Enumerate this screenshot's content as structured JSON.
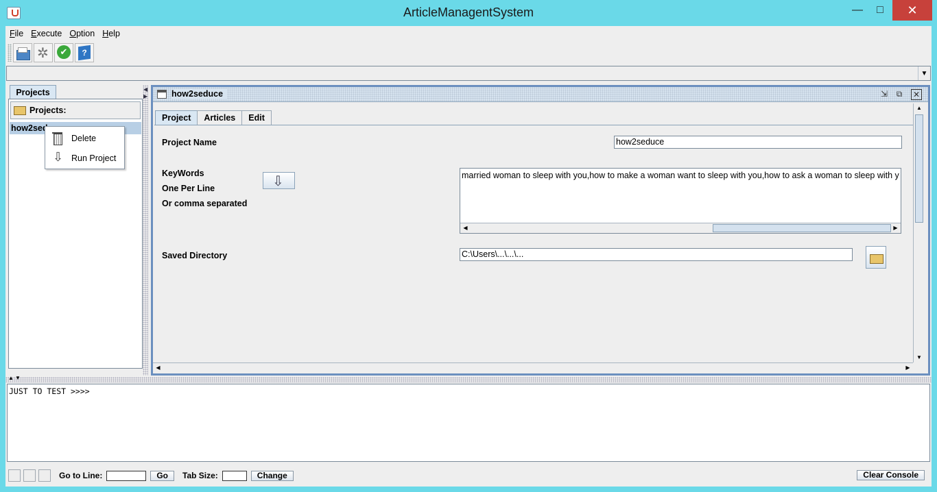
{
  "window": {
    "title": "ArticleManagentSystem",
    "minimize": "—",
    "maximize": "□",
    "close": "✕"
  },
  "menu": [
    {
      "mnemonic": "F",
      "rest": "ile"
    },
    {
      "mnemonic": "E",
      "rest": "xecute"
    },
    {
      "mnemonic": "O",
      "rest": "ption"
    },
    {
      "mnemonic": "H",
      "rest": "elp"
    }
  ],
  "toolbar": {
    "icons": [
      "folder-open-icon",
      "gear-icon",
      "check-icon",
      "help-icon"
    ]
  },
  "left_panel": {
    "tab_label": "Projects",
    "header_label": "Projects:",
    "tree_item": "how2seduce"
  },
  "context_menu": {
    "delete_label": "Delete",
    "run_label": "Run Project"
  },
  "frame": {
    "title": "how2seduce",
    "tabs": [
      "Project",
      "Articles",
      "Edit"
    ],
    "active_tab": "Project",
    "project_name_label": "Project Name",
    "project_name_value": "how2seduce",
    "keywords_label_1": "KeyWords",
    "keywords_label_2": "One Per Line",
    "keywords_label_3": "Or comma separated",
    "keywords_value": "married woman to sleep with you,how to make a woman want to sleep with you,how to ask a woman to sleep with you",
    "saved_dir_label": "Saved Directory",
    "saved_dir_value": "C:\\Users\\...\\...\\..."
  },
  "console": {
    "text": "JUST TO TEST >>>>"
  },
  "statusbar": {
    "goto_label": "Go to Line:",
    "go_button": "Go",
    "tab_size_label": "Tab Size:",
    "change_button": "Change",
    "clear_button": "Clear Console"
  }
}
